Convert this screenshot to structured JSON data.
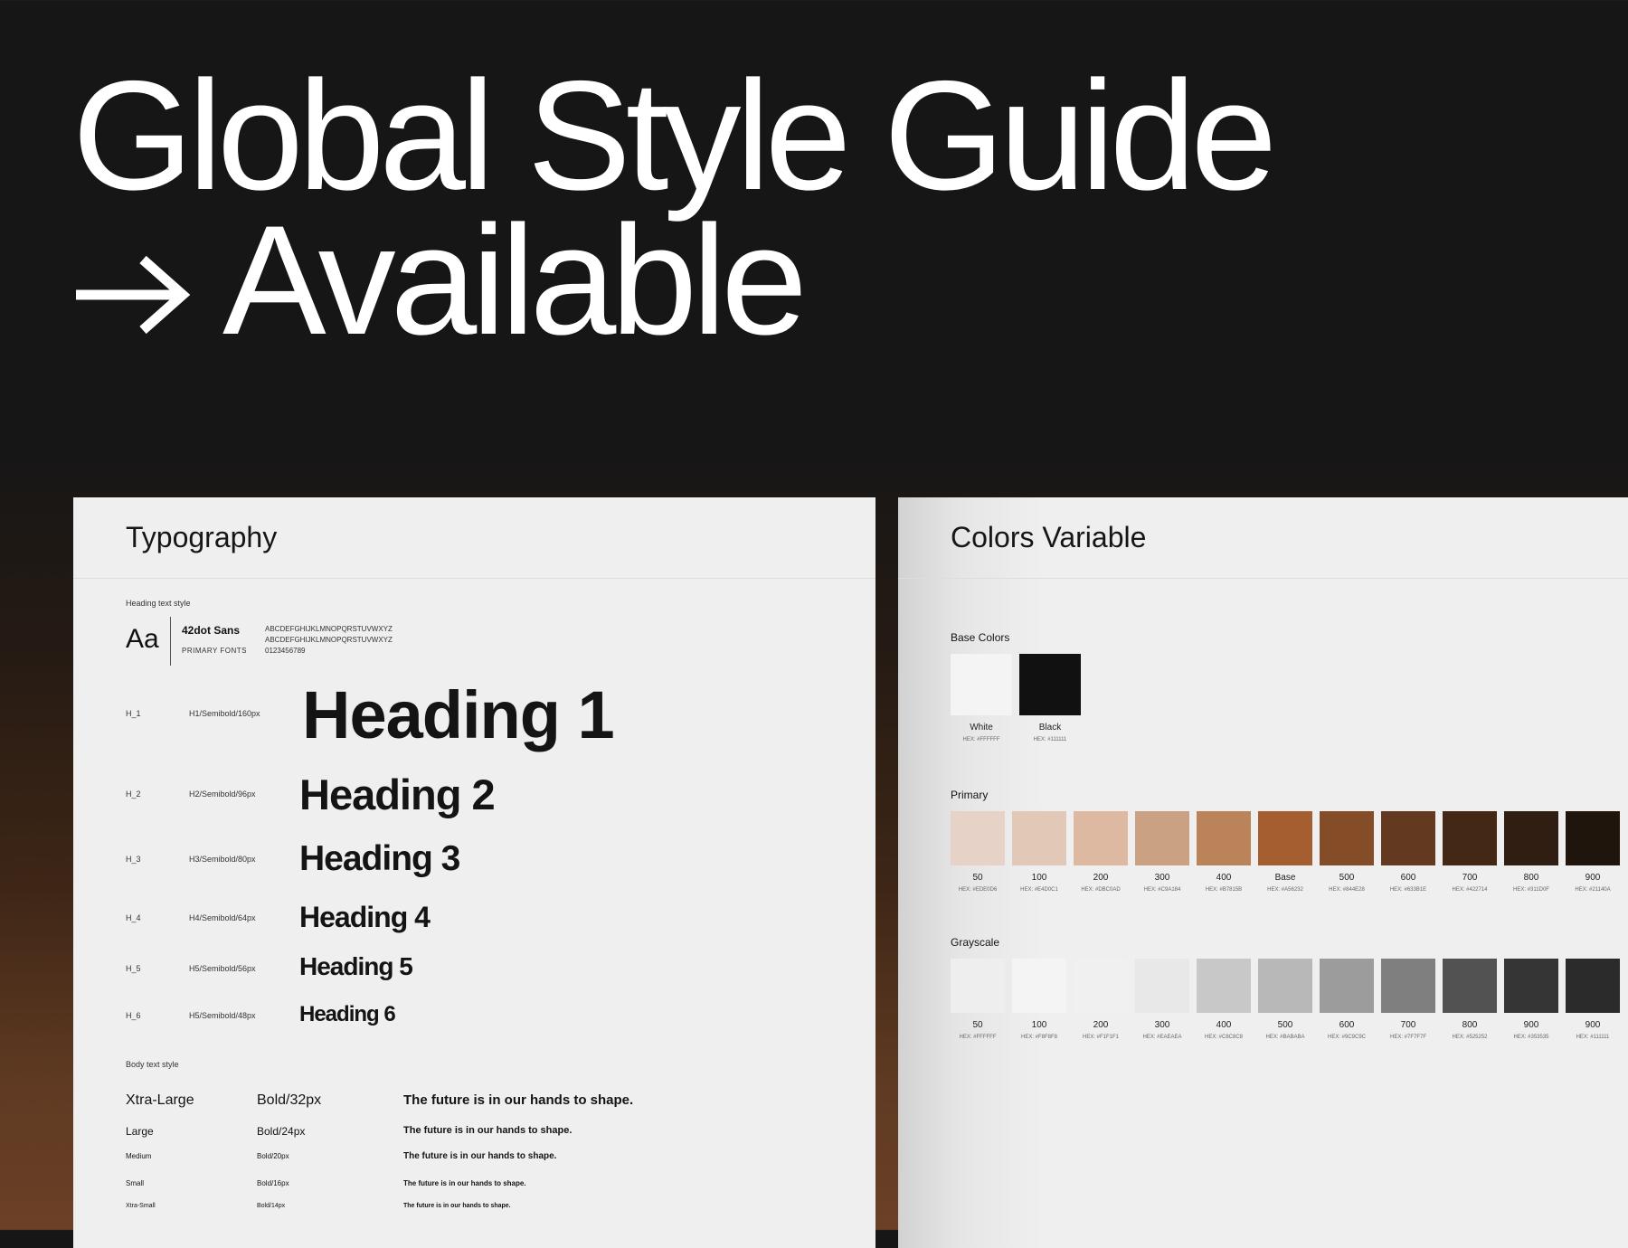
{
  "hero": {
    "line1": "Global Style Guide",
    "line2": "Available",
    "arrow_icon": "arrow-right-icon"
  },
  "typography": {
    "title": "Typography",
    "heading_section_label": "Heading text style",
    "font_specimen": "Aa",
    "font_name": "42dot Sans",
    "font_role": "PRIMARY FONTS",
    "glyphs_upper": "ABCDEFGHIJKLMNOPQRSTUVWXYZ",
    "glyphs_lower": "ABCDEFGHIJKLMNOPQRSTUVWXYZ",
    "glyphs_digits": "0123456789",
    "headings": [
      {
        "label": "H_1",
        "spec": "H1/Semibold/160px",
        "sample": "Heading 1"
      },
      {
        "label": "H_2",
        "spec": "H2/Semibold/96px",
        "sample": "Heading 2"
      },
      {
        "label": "H_3",
        "spec": "H3/Semibold/80px",
        "sample": "Heading 3"
      },
      {
        "label": "H_4",
        "spec": "H4/Semibold/64px",
        "sample": "Heading 4"
      },
      {
        "label": "H_5",
        "spec": "H5/Semibold/56px",
        "sample": "Heading 5"
      },
      {
        "label": "H_6",
        "spec": "H5/Semibold/48px",
        "sample": "Heading 6"
      }
    ],
    "body_section_label": "Body text style",
    "body_styles": [
      {
        "name": "Xtra-Large",
        "spec": "Bold/32px",
        "sample": "The future is in our hands to shape."
      },
      {
        "name": "Large",
        "spec": "Bold/24px",
        "sample": "The future is in our hands to shape."
      },
      {
        "name": "Medium",
        "spec": "Bold/20px",
        "sample": "The future is in our hands to shape."
      },
      {
        "name": "Small",
        "spec": "Bold/16px",
        "sample": "The future is in our hands to shape."
      },
      {
        "name": "Xtra-Small",
        "spec": "Bold/14px",
        "sample": "The future is in our hands to shape."
      }
    ]
  },
  "colors": {
    "title": "Colors Variable",
    "base_label": "Base Colors",
    "base": [
      {
        "name": "White",
        "hex": "HEX: #FFFFFF",
        "color": "#f4f4f4"
      },
      {
        "name": "Black",
        "hex": "HEX: #111111",
        "color": "#111111"
      }
    ],
    "primary_label": "Primary",
    "primary": [
      {
        "name": "50",
        "hex": "HEX: #EDE0D6",
        "color": "#e6d2c6"
      },
      {
        "name": "100",
        "hex": "HEX: #E4D0C1",
        "color": "#e2c8b6"
      },
      {
        "name": "200",
        "hex": "HEX: #DBC0AD",
        "color": "#deb9a2"
      },
      {
        "name": "300",
        "hex": "HEX: #C9A184",
        "color": "#cba183"
      },
      {
        "name": "400",
        "hex": "HEX: #B7815B",
        "color": "#bb8359"
      },
      {
        "name": "Base",
        "hex": "HEX: #A56232",
        "color": "#a45e2f"
      },
      {
        "name": "500",
        "hex": "HEX: #844E28",
        "color": "#844c27"
      },
      {
        "name": "600",
        "hex": "HEX: #633B1E",
        "color": "#633a1f"
      },
      {
        "name": "700",
        "hex": "HEX: #422714",
        "color": "#432816"
      },
      {
        "name": "800",
        "hex": "HEX: #311D0F",
        "color": "#301e12"
      },
      {
        "name": "900",
        "hex": "HEX: #21140A",
        "color": "#20150d"
      }
    ],
    "grayscale_label": "Grayscale",
    "grayscale": [
      {
        "name": "50",
        "hex": "HEX: #FFFFFF",
        "color": "#eeeeee"
      },
      {
        "name": "100",
        "hex": "HEX: #F8F8F8",
        "color": "#f4f4f4"
      },
      {
        "name": "200",
        "hex": "HEX: #F1F1F1",
        "color": "#f0f0f0"
      },
      {
        "name": "300",
        "hex": "HEX: #EAEAEA",
        "color": "#e8e8e8"
      },
      {
        "name": "400",
        "hex": "HEX: #C8C8C8",
        "color": "#c8c8c8"
      },
      {
        "name": "500",
        "hex": "HEX: #BABABA",
        "color": "#b8b8b8"
      },
      {
        "name": "600",
        "hex": "HEX: #9C9C9C",
        "color": "#9c9c9c"
      },
      {
        "name": "700",
        "hex": "HEX: #7F7F7F",
        "color": "#7f7f7f"
      },
      {
        "name": "800",
        "hex": "HEX: #525252",
        "color": "#525252"
      },
      {
        "name": "900",
        "hex": "HEX: #353535",
        "color": "#353535"
      },
      {
        "name": "900",
        "hex": "HEX: #111111",
        "color": "#2b2b2b"
      }
    ]
  }
}
